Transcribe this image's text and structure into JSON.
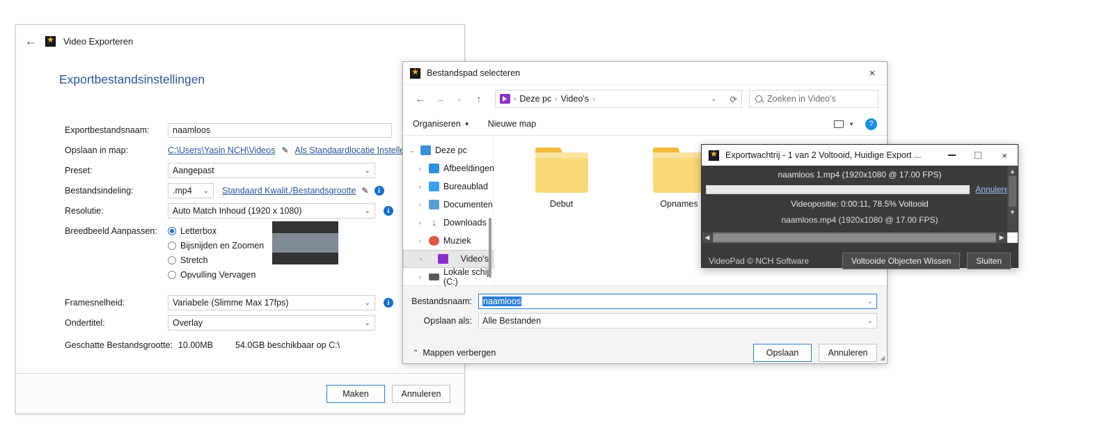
{
  "export_panel": {
    "title": "Video Exporteren",
    "back_icon": "back-arrow-icon",
    "heading": "Exportbestandsinstellingen",
    "fields": {
      "filename_label": "Exportbestandsnaam:",
      "filename_value": "naamloos",
      "folder_label": "Opslaan in map:",
      "folder_path": "C:\\Users\\Yasin NCH\\Videos",
      "folder_default_link": "Als Standaardlocatie Instellen",
      "preset_label": "Preset:",
      "preset_value": "Aangepast",
      "format_label": "Bestandsindeling:",
      "format_value": ".mp4",
      "format_link": "Standaard Kwalit./Bestandsgrootte",
      "resolution_label": "Resolutie:",
      "resolution_value": "Auto Match Inhoud (1920 x 1080)",
      "aspect_label": "Breedbeeld Aanpassen:",
      "aspect_options": [
        {
          "label": "Letterbox",
          "selected": true
        },
        {
          "label": "Bijsnijden en Zoomen",
          "selected": false
        },
        {
          "label": "Stretch",
          "selected": false
        },
        {
          "label": "Opvulling Vervagen",
          "selected": false
        }
      ],
      "framerate_label": "Framesnelheid:",
      "framerate_value": "Variabele (Slimme Max 17fps)",
      "subtitle_label": "Ondertitel:",
      "subtitle_value": "Overlay",
      "filesize_label": "Geschatte Bestandsgrootte:",
      "filesize_value": "10.00MB",
      "diskspace_value": "54.0GB beschikbaar op C:\\"
    },
    "footer": {
      "create_button": "Maken",
      "cancel_button": "Annuleren"
    }
  },
  "file_dialog": {
    "title": "Bestandspad selecteren",
    "close_icon": "×",
    "nav": {
      "back_icon": "←",
      "forward_icon": "→",
      "recent_icon": "⌄",
      "up_icon": "↑",
      "breadcrumbs": [
        "Deze pc",
        "Video's"
      ],
      "dropdown_icon": "⌄",
      "refresh_icon": "⟳",
      "search_placeholder": "Zoeken in Video's"
    },
    "toolbar": {
      "organize": "Organiseren",
      "new_folder": "Nieuwe map",
      "view_icon": "view-layout-icon",
      "help_icon": "?"
    },
    "tree": [
      {
        "label": "Deze pc",
        "level": 0,
        "expanded": true,
        "color": "#3a8fd8",
        "selected": false
      },
      {
        "label": "Afbeeldingen",
        "level": 1,
        "expanded": false,
        "color": "#2f8fe0",
        "selected": false
      },
      {
        "label": "Bureaublad",
        "level": 1,
        "expanded": false,
        "color": "#3aa0e8",
        "selected": false
      },
      {
        "label": "Documenten",
        "level": 1,
        "expanded": false,
        "color": "#5a9fd0",
        "selected": false
      },
      {
        "label": "Downloads",
        "level": 1,
        "expanded": false,
        "color": "#4a4a4a",
        "selected": false
      },
      {
        "label": "Muziek",
        "level": 1,
        "expanded": false,
        "color": "#e0574a",
        "selected": false
      },
      {
        "label": "Video's",
        "level": 1,
        "expanded": false,
        "color": "#8b2fc9",
        "selected": true
      },
      {
        "label": "Lokale schijf (C:)",
        "level": 1,
        "expanded": false,
        "color": "#5a5a5a",
        "selected": false
      }
    ],
    "files": [
      {
        "name": "Debut",
        "type": "folder"
      },
      {
        "name": "Opnames",
        "type": "folder"
      }
    ],
    "fields": {
      "filename_label": "Bestandsnaam:",
      "filename_value": "naamloos",
      "savetype_label": "Opslaan als:",
      "savetype_value": "Alle Bestanden"
    },
    "footer": {
      "hide_folders": "Mappen verbergen",
      "save_button": "Opslaan",
      "cancel_button": "Annuleren"
    }
  },
  "export_queue": {
    "title": "Exportwachtrij - 1 van 2 Voltooid, Huidige Export ...",
    "minimize_icon": "−",
    "maximize_icon": "□",
    "close_icon": "×",
    "items": [
      {
        "name": "naamloos 1.mp4 (1920x1080 @ 17.00 FPS)",
        "progress_percent": 10,
        "cancel_link": "Annuleren",
        "status": "Videopositie: 0:00:11, 78.5% Voltooid"
      },
      {
        "name": "naamloos.mp4 (1920x1080 @ 17.00 FPS)"
      }
    ],
    "brand": "VideoPad © NCH Software",
    "clear_button": "Voltooide Objecten Wissen",
    "close_button": "Sluiten"
  },
  "colors": {
    "accent_blue": "#2a5699",
    "link_blue": "#2a5699",
    "progress_green": "#12b21a",
    "selection_blue": "#2a7fd4"
  }
}
